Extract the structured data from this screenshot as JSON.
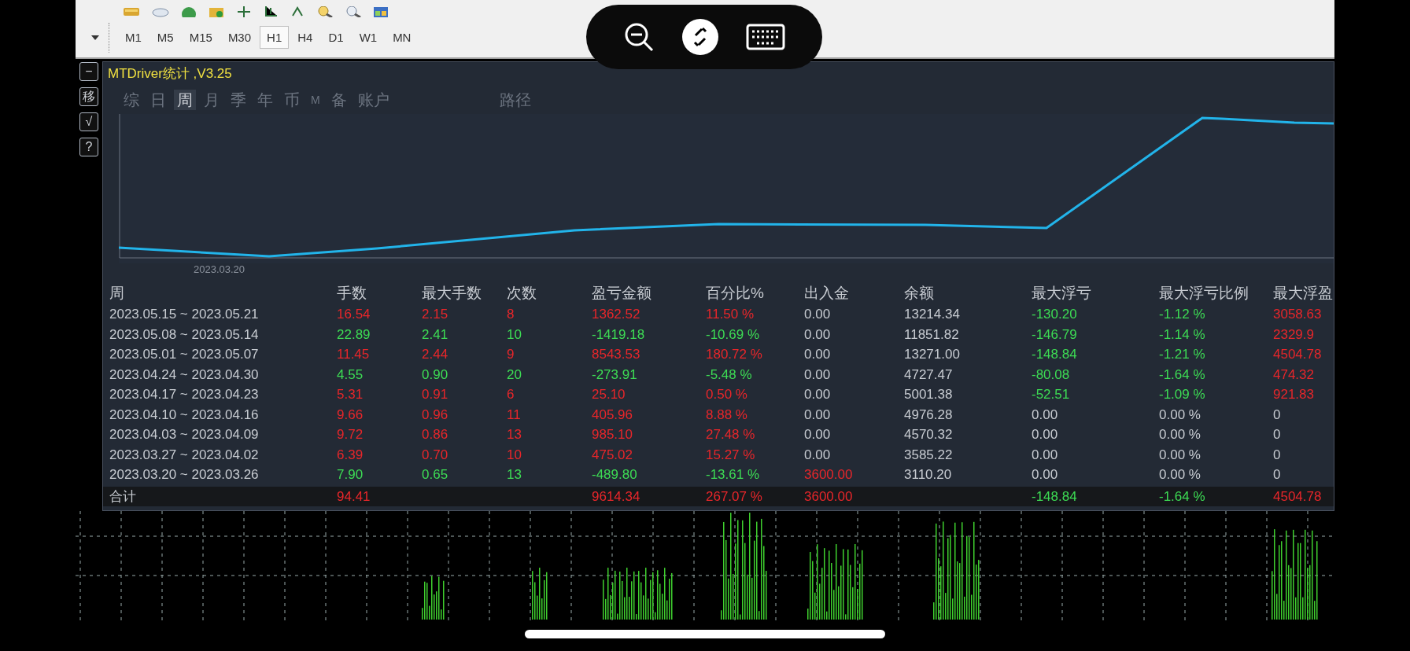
{
  "toolbar": {
    "timeframes": [
      {
        "label": "M1",
        "selected": false
      },
      {
        "label": "M5",
        "selected": false
      },
      {
        "label": "M15",
        "selected": false
      },
      {
        "label": "M30",
        "selected": false
      },
      {
        "label": "H1",
        "selected": true
      },
      {
        "label": "H4",
        "selected": false
      },
      {
        "label": "D1",
        "selected": false
      },
      {
        "label": "W1",
        "selected": false
      },
      {
        "label": "MN",
        "selected": false
      }
    ]
  },
  "side_buttons": [
    "−",
    "移",
    "√",
    "?"
  ],
  "panel": {
    "title": "MTDriver统计 ,V3.25",
    "tabs": [
      {
        "label": "综",
        "selected": false
      },
      {
        "label": "日",
        "selected": false
      },
      {
        "label": "周",
        "selected": true
      },
      {
        "label": "月",
        "selected": false
      },
      {
        "label": "季",
        "selected": false
      },
      {
        "label": "年",
        "selected": false
      },
      {
        "label": "币",
        "selected": false
      },
      {
        "label": "M",
        "selected": false
      },
      {
        "label": "备",
        "selected": false
      },
      {
        "label": "账户",
        "selected": false
      }
    ],
    "path_label": "路径",
    "chart_date_label": "2023.03.20",
    "table": {
      "columns": [
        "周",
        "手数",
        "最大手数",
        "次数",
        "盈亏金额",
        "百分比%",
        "出入金",
        "余额",
        "最大浮亏",
        "最大浮亏比例",
        "最大浮盈"
      ],
      "rows": [
        {
          "cells": [
            {
              "text": "2023.05.15 ~ 2023.05.21",
              "color": "#c8ccd2"
            },
            {
              "text": "16.54",
              "color": "#e8262a"
            },
            {
              "text": "2.15",
              "color": "#e8262a"
            },
            {
              "text": "8",
              "color": "#e8262a"
            },
            {
              "text": "1362.52",
              "color": "#e8262a"
            },
            {
              "text": "11.50 %",
              "color": "#e8262a"
            },
            {
              "text": "0.00",
              "color": "#c8ccd2"
            },
            {
              "text": "13214.34",
              "color": "#c8ccd2"
            },
            {
              "text": "-130.20",
              "color": "#3ddc54"
            },
            {
              "text": "-1.12 %",
              "color": "#3ddc54"
            },
            {
              "text": "3058.63",
              "color": "#e8262a"
            }
          ]
        },
        {
          "cells": [
            {
              "text": "2023.05.08 ~ 2023.05.14",
              "color": "#c8ccd2"
            },
            {
              "text": "22.89",
              "color": "#3ddc54"
            },
            {
              "text": "2.41",
              "color": "#3ddc54"
            },
            {
              "text": "10",
              "color": "#3ddc54"
            },
            {
              "text": "-1419.18",
              "color": "#3ddc54"
            },
            {
              "text": "-10.69 %",
              "color": "#3ddc54"
            },
            {
              "text": "0.00",
              "color": "#c8ccd2"
            },
            {
              "text": "11851.82",
              "color": "#c8ccd2"
            },
            {
              "text": "-146.79",
              "color": "#3ddc54"
            },
            {
              "text": "-1.14 %",
              "color": "#3ddc54"
            },
            {
              "text": "2329.9",
              "color": "#e8262a"
            }
          ]
        },
        {
          "cells": [
            {
              "text": "2023.05.01 ~ 2023.05.07",
              "color": "#c8ccd2"
            },
            {
              "text": "11.45",
              "color": "#e8262a"
            },
            {
              "text": "2.44",
              "color": "#e8262a"
            },
            {
              "text": "9",
              "color": "#e8262a"
            },
            {
              "text": "8543.53",
              "color": "#e8262a"
            },
            {
              "text": "180.72 %",
              "color": "#e8262a"
            },
            {
              "text": "0.00",
              "color": "#c8ccd2"
            },
            {
              "text": "13271.00",
              "color": "#c8ccd2"
            },
            {
              "text": "-148.84",
              "color": "#3ddc54"
            },
            {
              "text": "-1.21 %",
              "color": "#3ddc54"
            },
            {
              "text": "4504.78",
              "color": "#e8262a"
            }
          ]
        },
        {
          "cells": [
            {
              "text": "2023.04.24 ~ 2023.04.30",
              "color": "#c8ccd2"
            },
            {
              "text": "4.55",
              "color": "#3ddc54"
            },
            {
              "text": "0.90",
              "color": "#3ddc54"
            },
            {
              "text": "20",
              "color": "#3ddc54"
            },
            {
              "text": "-273.91",
              "color": "#3ddc54"
            },
            {
              "text": "-5.48 %",
              "color": "#3ddc54"
            },
            {
              "text": "0.00",
              "color": "#c8ccd2"
            },
            {
              "text": "4727.47",
              "color": "#c8ccd2"
            },
            {
              "text": "-80.08",
              "color": "#3ddc54"
            },
            {
              "text": "-1.64 %",
              "color": "#3ddc54"
            },
            {
              "text": "474.32",
              "color": "#e8262a"
            }
          ]
        },
        {
          "cells": [
            {
              "text": "2023.04.17 ~ 2023.04.23",
              "color": "#c8ccd2"
            },
            {
              "text": "5.31",
              "color": "#e8262a"
            },
            {
              "text": "0.91",
              "color": "#e8262a"
            },
            {
              "text": "6",
              "color": "#e8262a"
            },
            {
              "text": "25.10",
              "color": "#e8262a"
            },
            {
              "text": "0.50 %",
              "color": "#e8262a"
            },
            {
              "text": "0.00",
              "color": "#c8ccd2"
            },
            {
              "text": "5001.38",
              "color": "#c8ccd2"
            },
            {
              "text": "-52.51",
              "color": "#3ddc54"
            },
            {
              "text": "-1.09 %",
              "color": "#3ddc54"
            },
            {
              "text": "921.83",
              "color": "#e8262a"
            }
          ]
        },
        {
          "cells": [
            {
              "text": "2023.04.10 ~ 2023.04.16",
              "color": "#c8ccd2"
            },
            {
              "text": "9.66",
              "color": "#e8262a"
            },
            {
              "text": "0.96",
              "color": "#e8262a"
            },
            {
              "text": "11",
              "color": "#e8262a"
            },
            {
              "text": "405.96",
              "color": "#e8262a"
            },
            {
              "text": "8.88 %",
              "color": "#e8262a"
            },
            {
              "text": "0.00",
              "color": "#c8ccd2"
            },
            {
              "text": "4976.28",
              "color": "#c8ccd2"
            },
            {
              "text": "0.00",
              "color": "#c8ccd2"
            },
            {
              "text": "0.00 %",
              "color": "#c8ccd2"
            },
            {
              "text": "0",
              "color": "#c8ccd2"
            }
          ]
        },
        {
          "cells": [
            {
              "text": "2023.04.03 ~ 2023.04.09",
              "color": "#c8ccd2"
            },
            {
              "text": "9.72",
              "color": "#e8262a"
            },
            {
              "text": "0.86",
              "color": "#e8262a"
            },
            {
              "text": "13",
              "color": "#e8262a"
            },
            {
              "text": "985.10",
              "color": "#e8262a"
            },
            {
              "text": "27.48 %",
              "color": "#e8262a"
            },
            {
              "text": "0.00",
              "color": "#c8ccd2"
            },
            {
              "text": "4570.32",
              "color": "#c8ccd2"
            },
            {
              "text": "0.00",
              "color": "#c8ccd2"
            },
            {
              "text": "0.00 %",
              "color": "#c8ccd2"
            },
            {
              "text": "0",
              "color": "#c8ccd2"
            }
          ]
        },
        {
          "cells": [
            {
              "text": "2023.03.27 ~ 2023.04.02",
              "color": "#c8ccd2"
            },
            {
              "text": "6.39",
              "color": "#e8262a"
            },
            {
              "text": "0.70",
              "color": "#e8262a"
            },
            {
              "text": "10",
              "color": "#e8262a"
            },
            {
              "text": "475.02",
              "color": "#e8262a"
            },
            {
              "text": "15.27 %",
              "color": "#e8262a"
            },
            {
              "text": "0.00",
              "color": "#c8ccd2"
            },
            {
              "text": "3585.22",
              "color": "#c8ccd2"
            },
            {
              "text": "0.00",
              "color": "#c8ccd2"
            },
            {
              "text": "0.00 %",
              "color": "#c8ccd2"
            },
            {
              "text": "0",
              "color": "#c8ccd2"
            }
          ]
        },
        {
          "cells": [
            {
              "text": "2023.03.20 ~ 2023.03.26",
              "color": "#c8ccd2"
            },
            {
              "text": "7.90",
              "color": "#3ddc54"
            },
            {
              "text": "0.65",
              "color": "#3ddc54"
            },
            {
              "text": "13",
              "color": "#3ddc54"
            },
            {
              "text": "-489.80",
              "color": "#3ddc54"
            },
            {
              "text": "-13.61 %",
              "color": "#3ddc54"
            },
            {
              "text": "3600.00",
              "color": "#e8262a"
            },
            {
              "text": "3110.20",
              "color": "#c8ccd2"
            },
            {
              "text": "0.00",
              "color": "#c8ccd2"
            },
            {
              "text": "0.00 %",
              "color": "#c8ccd2"
            },
            {
              "text": "0",
              "color": "#c8ccd2"
            }
          ]
        }
      ],
      "total": {
        "cells": [
          {
            "text": "合计",
            "color": "#c8ccd2"
          },
          {
            "text": "94.41",
            "color": "#e8262a"
          },
          null,
          null,
          {
            "text": "9614.34",
            "color": "#e8262a"
          },
          {
            "text": "267.07 %",
            "color": "#e8262a"
          },
          {
            "text": "3600.00",
            "color": "#e8262a"
          },
          null,
          {
            "text": "-148.84",
            "color": "#3ddc54"
          },
          {
            "text": "-1.64 %",
            "color": "#3ddc54"
          },
          {
            "text": "4504.78",
            "color": "#e8262a"
          }
        ]
      }
    }
  }
}
